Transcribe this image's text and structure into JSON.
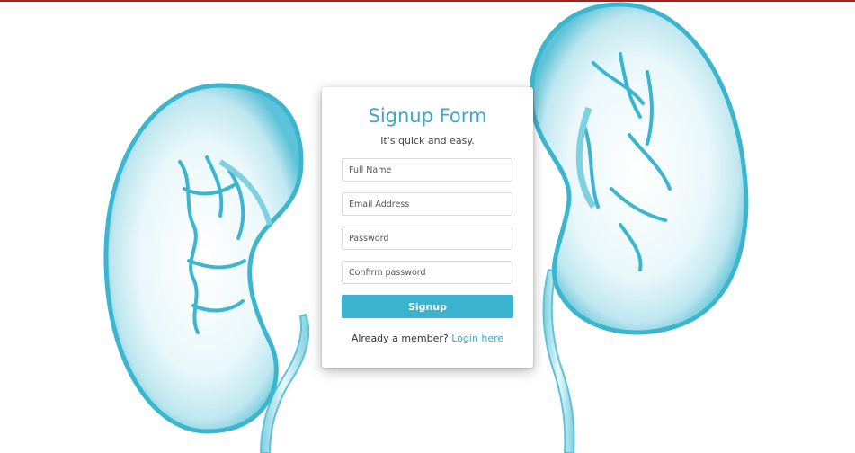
{
  "signup": {
    "title": "Signup Form",
    "subtitle": "It's quick and easy.",
    "fields": {
      "full_name_placeholder": "Full Name",
      "email_placeholder": "Email Address",
      "password_placeholder": "Password",
      "confirm_password_placeholder": "Confirm password"
    },
    "submit_label": "Signup",
    "member_prompt": "Already a member?",
    "login_link": "Login here"
  },
  "colors": {
    "accent": "#3aa8c8",
    "button": "#3cb3ce",
    "top_bar": "#a3221e",
    "kidney": "#3cb6cf"
  },
  "background": {
    "icon": "kidney-illustration"
  }
}
